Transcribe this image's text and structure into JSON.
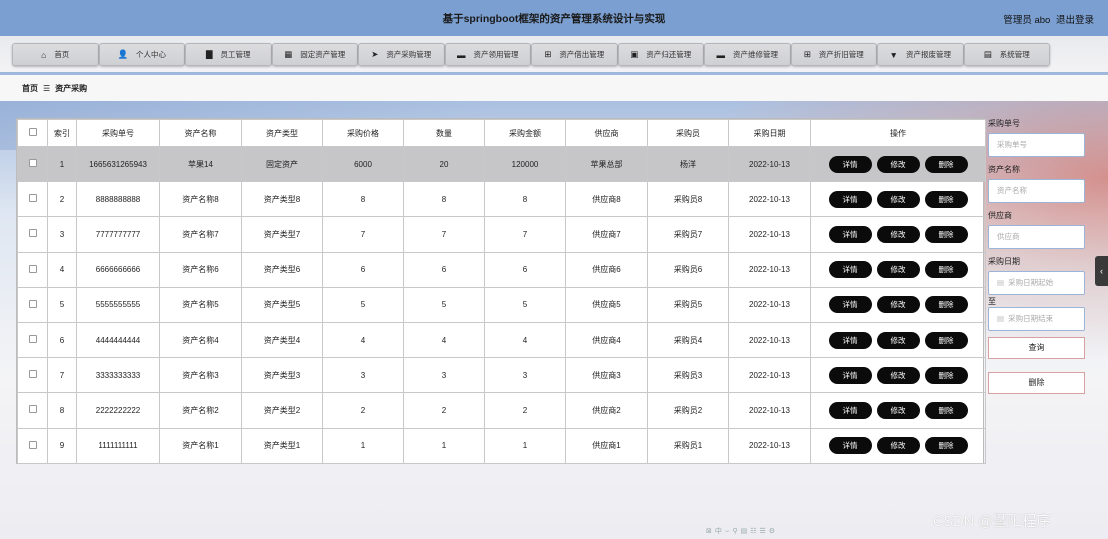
{
  "header": {
    "title": "基于springboot框架的资产管理系统设计与实现",
    "user": "管理员 abo",
    "logout": "退出登录"
  },
  "nav": [
    {
      "label": "首页",
      "icon": "⌂"
    },
    {
      "label": "个人中心",
      "icon": "👤"
    },
    {
      "label": "员工管理",
      "icon": "▇"
    },
    {
      "label": "固定资产管理",
      "icon": "▦"
    },
    {
      "label": "资产采购管理",
      "icon": "➤"
    },
    {
      "label": "资产领用管理",
      "icon": "▬"
    },
    {
      "label": "资产借出管理",
      "icon": "⊞"
    },
    {
      "label": "资产归还管理",
      "icon": "▣"
    },
    {
      "label": "资产维修管理",
      "icon": "▬"
    },
    {
      "label": "资产折旧管理",
      "icon": "⊞"
    },
    {
      "label": "资产报废管理",
      "icon": "▼"
    },
    {
      "label": "系统管理",
      "icon": "▤"
    }
  ],
  "breadcrumb": {
    "home": "首页",
    "sep": "☰",
    "current": "资产采购"
  },
  "table": {
    "headers": [
      "索引",
      "采购单号",
      "资产名称",
      "资产类型",
      "采购价格",
      "数量",
      "采购金额",
      "供应商",
      "采购员",
      "采购日期",
      "操作"
    ],
    "rows": [
      [
        "1",
        "1665631265943",
        "苹果14",
        "固定资产",
        "6000",
        "20",
        "120000",
        "苹果总部",
        "杨洋",
        "2022-10-13"
      ],
      [
        "2",
        "8888888888",
        "资产名称8",
        "资产类型8",
        "8",
        "8",
        "8",
        "供应商8",
        "采购员8",
        "2022-10-13"
      ],
      [
        "3",
        "7777777777",
        "资产名称7",
        "资产类型7",
        "7",
        "7",
        "7",
        "供应商7",
        "采购员7",
        "2022-10-13"
      ],
      [
        "4",
        "6666666666",
        "资产名称6",
        "资产类型6",
        "6",
        "6",
        "6",
        "供应商6",
        "采购员6",
        "2022-10-13"
      ],
      [
        "5",
        "5555555555",
        "资产名称5",
        "资产类型5",
        "5",
        "5",
        "5",
        "供应商5",
        "采购员5",
        "2022-10-13"
      ],
      [
        "6",
        "4444444444",
        "资产名称4",
        "资产类型4",
        "4",
        "4",
        "4",
        "供应商4",
        "采购员4",
        "2022-10-13"
      ],
      [
        "7",
        "3333333333",
        "资产名称3",
        "资产类型3",
        "3",
        "3",
        "3",
        "供应商3",
        "采购员3",
        "2022-10-13"
      ],
      [
        "8",
        "2222222222",
        "资产名称2",
        "资产类型2",
        "2",
        "2",
        "2",
        "供应商2",
        "采购员2",
        "2022-10-13"
      ],
      [
        "9",
        "1111111111",
        "资产名称1",
        "资产类型1",
        "1",
        "1",
        "1",
        "供应商1",
        "采购员1",
        "2022-10-13"
      ]
    ],
    "actions": [
      "详情",
      "修改",
      "删除"
    ]
  },
  "search": {
    "order_label": "采购单号",
    "order_placeholder": "采购单号",
    "name_label": "资产名称",
    "name_placeholder": "资产名称",
    "supplier_label": "供应商",
    "supplier_placeholder": "供应商",
    "date_label": "采购日期",
    "date_start_placeholder": "采购日期起始",
    "to_label": "至",
    "date_end_placeholder": "采购日期结束",
    "query_button": "查询",
    "delete_button": "删除"
  },
  "side_tab": "‹",
  "footer": {
    "icons": "⊠中⌣⚲▤☷☰⚙",
    "watermark": "CSDN @暨阳程序"
  }
}
